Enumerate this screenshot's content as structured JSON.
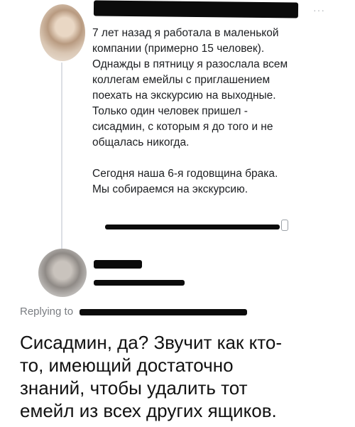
{
  "post": {
    "menu_icon": "more-dots-icon",
    "paragraph_1": "7 лет назад я работала в маленькой\nкомпании (примерно 15 человек).\nОднажды в пятницу я разослала всем\nколлегам емейлы с приглашением\nпоехать на экскурсию на выходные.\nТолько один человек пришел -\nсисадмин, с которым я до того и не\nобщалась никогда.",
    "paragraph_2": "Сегодня наша 6-я годовщина брака.\nМы собираемся на экскурсию."
  },
  "reply": {
    "replying_to_label": "Replying to",
    "text": "Сисадмин, да? Звучит как кто-\nто, имеющий достаточно\nзнаний, чтобы удалить тот\nемейл из всех других ящиков."
  }
}
